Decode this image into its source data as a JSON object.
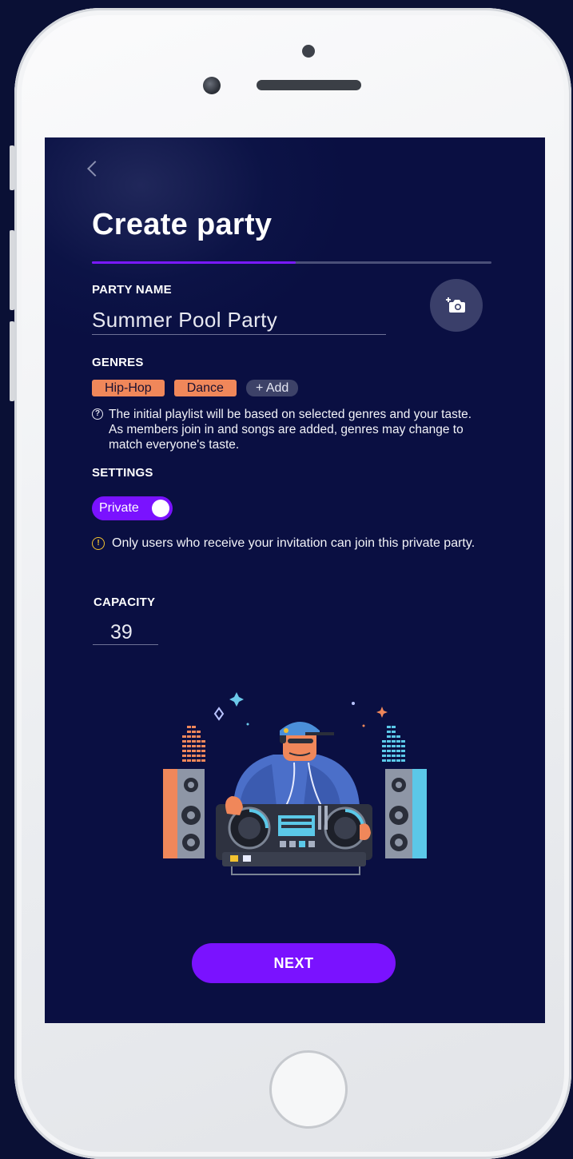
{
  "screen": {
    "title": "Create party",
    "progress": 0.51,
    "back_icon": "chevron-left-icon"
  },
  "party_name": {
    "label": "PARTY NAME",
    "value": "Summer Pool Party",
    "photo_icon": "add-photo-camera-icon"
  },
  "genres": {
    "label": "GENRES",
    "items": [
      "Hip-Hop",
      "Dance"
    ],
    "add_label": "+ Add",
    "help_icon": "question-circle-icon",
    "help_text": "The initial playlist will be based on selected genres and your taste. As members join in and songs are added, genres may change to match everyone's taste."
  },
  "settings": {
    "label": "SETTINGS",
    "toggle_label": "Private",
    "toggle_on": true,
    "warning_icon": "warning-circle-icon",
    "warning_text": "Only users who receive your invitation can join this private party."
  },
  "capacity": {
    "label": "CAPACITY",
    "value": "39"
  },
  "illustration": "dj-mixing-illustration",
  "next_label": "NEXT",
  "colors": {
    "accent": "#7a12ff",
    "background": "#0a0f42",
    "chip": "#f0875a",
    "warning": "#f2c230"
  }
}
